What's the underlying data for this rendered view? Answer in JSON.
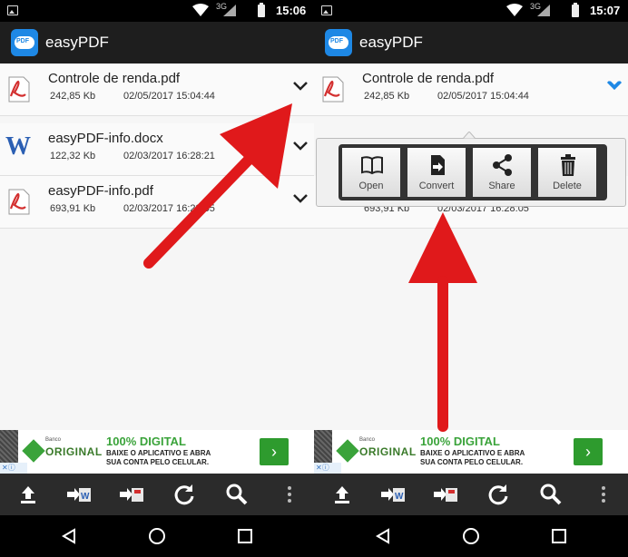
{
  "screens": [
    {
      "status": {
        "network": "3G",
        "time": "15:06"
      },
      "app_title": "easyPDF",
      "files": [
        {
          "name": "Controle de renda.pdf",
          "size": "242,85 Kb",
          "date": "02/05/2017 15:04:44",
          "type": "pdf"
        },
        {
          "name": "easyPDF-info.docx",
          "size": "122,32 Kb",
          "date": "02/03/2017 16:28:21",
          "type": "docx"
        },
        {
          "name": "easyPDF-info.pdf",
          "size": "693,91 Kb",
          "date": "02/03/2017 16:28:05",
          "type": "pdf"
        }
      ]
    },
    {
      "status": {
        "network": "3G",
        "time": "15:07"
      },
      "app_title": "easyPDF",
      "files": [
        {
          "name": "Controle de renda.pdf",
          "size": "242,85 Kb",
          "date": "02/05/2017 15:04:44",
          "type": "pdf"
        },
        {
          "name": "",
          "size": "693,91 Kb",
          "date": "02/03/2017 16:28:05",
          "type": "pdf"
        }
      ],
      "popup_menu": [
        {
          "label": "Open",
          "icon": "book-icon"
        },
        {
          "label": "Convert",
          "icon": "convert-icon"
        },
        {
          "label": "Share",
          "icon": "share-icon"
        },
        {
          "label": "Delete",
          "icon": "trash-icon"
        }
      ]
    }
  ],
  "ad": {
    "bank_small": "Banco",
    "brand": "ORIGINAL",
    "headline": "100% DIGITAL",
    "line1": "BAIXE O APLICATIVO E ABRA",
    "line2": "SUA CONTA PELO CELULAR.",
    "go": "›",
    "info": "✕ⓘ"
  },
  "colors": {
    "arrow": "#e0191b",
    "accent": "#1e88e5",
    "ad_green": "#3aa33a"
  }
}
